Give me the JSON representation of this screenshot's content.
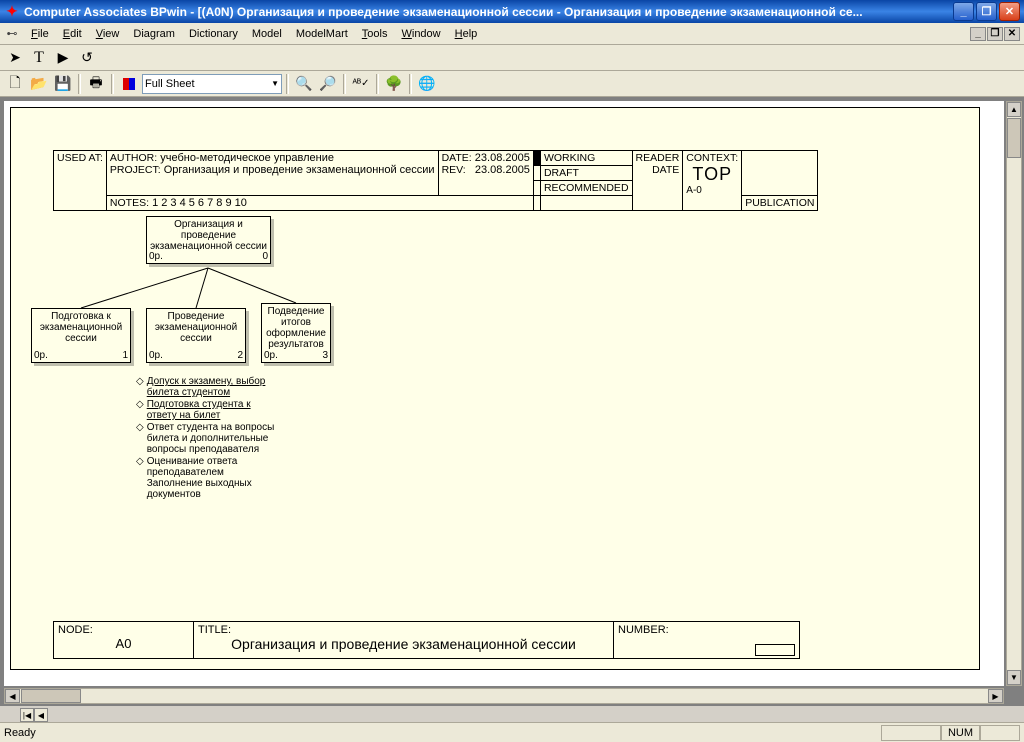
{
  "app": {
    "title": "Computer Associates BPwin - [(A0N) Организация и проведение  экзаменационной сессии   - Организация и проведение экзаменационной се..."
  },
  "menu": {
    "file": "File",
    "edit": "Edit",
    "view": "View",
    "diagram": "Diagram",
    "dictionary": "Dictionary",
    "model": "Model",
    "modelmart": "ModelMart",
    "tools": "Tools",
    "window": "Window",
    "help": "Help"
  },
  "toolbar": {
    "zoom": "Full Sheet"
  },
  "header": {
    "used_at": "USED AT:",
    "author_lbl": "AUTHOR:",
    "author": "учебно-методическое управление",
    "project_lbl": "PROJECT:",
    "project": "Организация и проведение экзаменационной сессии",
    "notes_lbl": "NOTES:",
    "notes": "1  2  3  4  5  6  7  8  9  10",
    "date_lbl": "DATE:",
    "date": "23.08.2005",
    "rev_lbl": "REV:",
    "rev": "23.08.2005",
    "working": "WORKING",
    "draft": "DRAFT",
    "recommended": "RECOMMENDED",
    "publication": "PUBLICATION",
    "reader": "READER",
    "reader_date": "DATE",
    "context_lbl": "CONTEXT:",
    "context_top": "TOP",
    "context_id": "A-0"
  },
  "diagram": {
    "root": {
      "title": "Организация и проведение экзаменационной сессии",
      "op": "0р.",
      "num": "0"
    },
    "children": [
      {
        "title": "Подготовка к экзаменационной сессии",
        "op": "0р.",
        "num": "1"
      },
      {
        "title": "Проведение экзаменационной сессии",
        "op": "0р.",
        "num": "2"
      },
      {
        "title": "Подведение итогов оформление результатов",
        "op": "0р.",
        "num": "3"
      }
    ],
    "activities": [
      "Допуск к экзамену, выбор билета студентом",
      "Подготовка студента к ответу  на билет",
      "Ответ студента на вопросы билета и дополнительные вопросы преподавателя",
      "Оценивание ответа преподавателем Заполнение выходных документов"
    ]
  },
  "footer": {
    "node_lbl": "NODE:",
    "node": "A0",
    "title_lbl": "TITLE:",
    "title": "Организация и проведение  экзаменационной сессии",
    "number_lbl": "NUMBER:"
  },
  "status": {
    "ready": "Ready",
    "num": "NUM"
  }
}
